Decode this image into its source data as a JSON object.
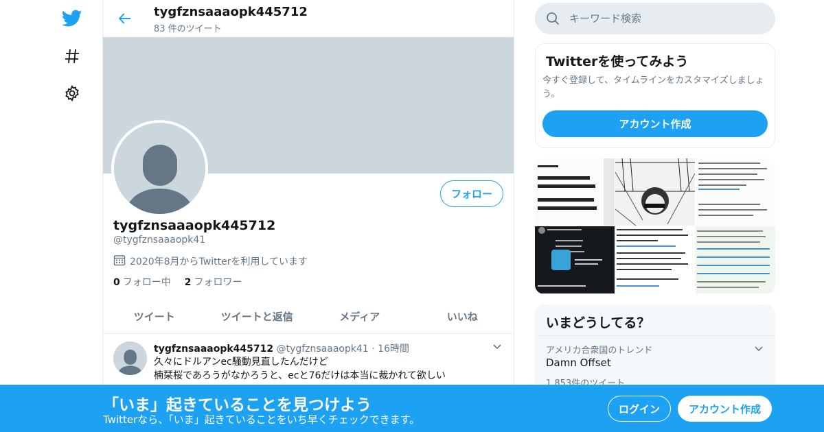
{
  "colors": {
    "accent": "#1da1f2",
    "banner": "#ccd6dd",
    "muted": "#657786",
    "text": "#14171a",
    "border": "#e6ecf0"
  },
  "nav": {
    "icons": [
      "twitter-bird-icon",
      "hashtag-icon",
      "gear-icon"
    ]
  },
  "header": {
    "name": "tygfznsaaaopk445712",
    "tweet_count": "83 件のツイート"
  },
  "profile": {
    "name": "tygfznsaaaopk445712",
    "handle": "@tygfznsaaaopk41",
    "joined": "2020年8月からTwitterを利用しています",
    "following_count": "0",
    "following_label": "フォロー中",
    "followers_count": "2",
    "followers_label": "フォロワー",
    "follow_button": "フォロー"
  },
  "tabs": [
    "ツイート",
    "ツイートと返信",
    "メディア",
    "いいね"
  ],
  "tweet": {
    "name": "tygfznsaaaopk445712",
    "handle": "@tygfznsaaaopk41",
    "separator": "·",
    "time": "16時間",
    "line1": "久々にドルアンec騒動見直したんだけど",
    "line2": "楠栞桜であろうがなかろうと、ecと76だけは本当に裁かれて欲しい"
  },
  "search": {
    "placeholder": "キーワード検索"
  },
  "signup_card": {
    "title": "Twitterを使ってみよう",
    "description": "今すぐ登録して、タイムラインをカスタマイズしましょう。",
    "button": "アカウント作成"
  },
  "trends": {
    "title": "いまどうしてる？",
    "item": {
      "meta": "アメリカ合衆国のトレンド",
      "name": "Damn Offset",
      "count": "1,853件のツイート"
    }
  },
  "bottom_bar": {
    "headline": "「いま」起きていることを見つけよう",
    "subtext": "Twitterなら、「いま」起きていることをいち早くチェックできます。",
    "login": "ログイン",
    "signup": "アカウント作成"
  }
}
